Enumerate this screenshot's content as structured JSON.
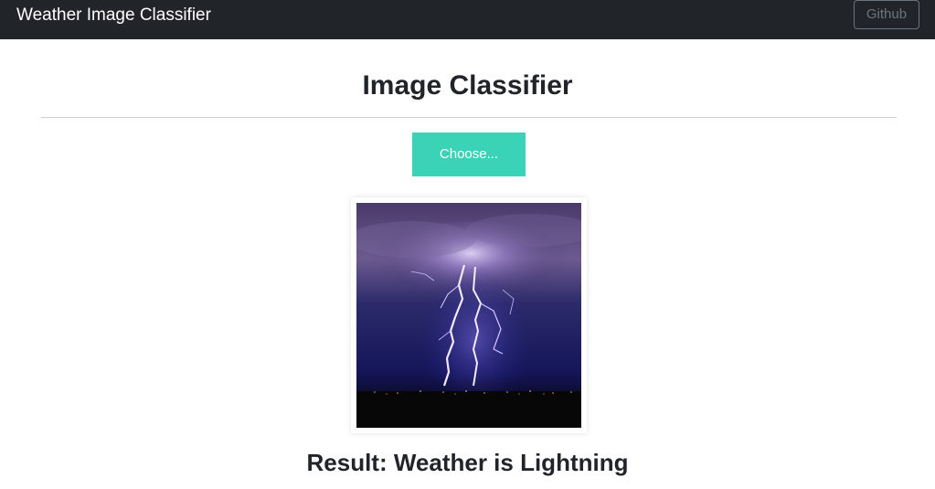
{
  "navbar": {
    "brand": "Weather Image Classifier",
    "github_label": "Github"
  },
  "main": {
    "title": "Image Classifier",
    "choose_label": "Choose...",
    "result_text": "Result: Weather is Lightning"
  },
  "colors": {
    "navbar_bg": "#212529",
    "accent": "#3ad3b8"
  }
}
